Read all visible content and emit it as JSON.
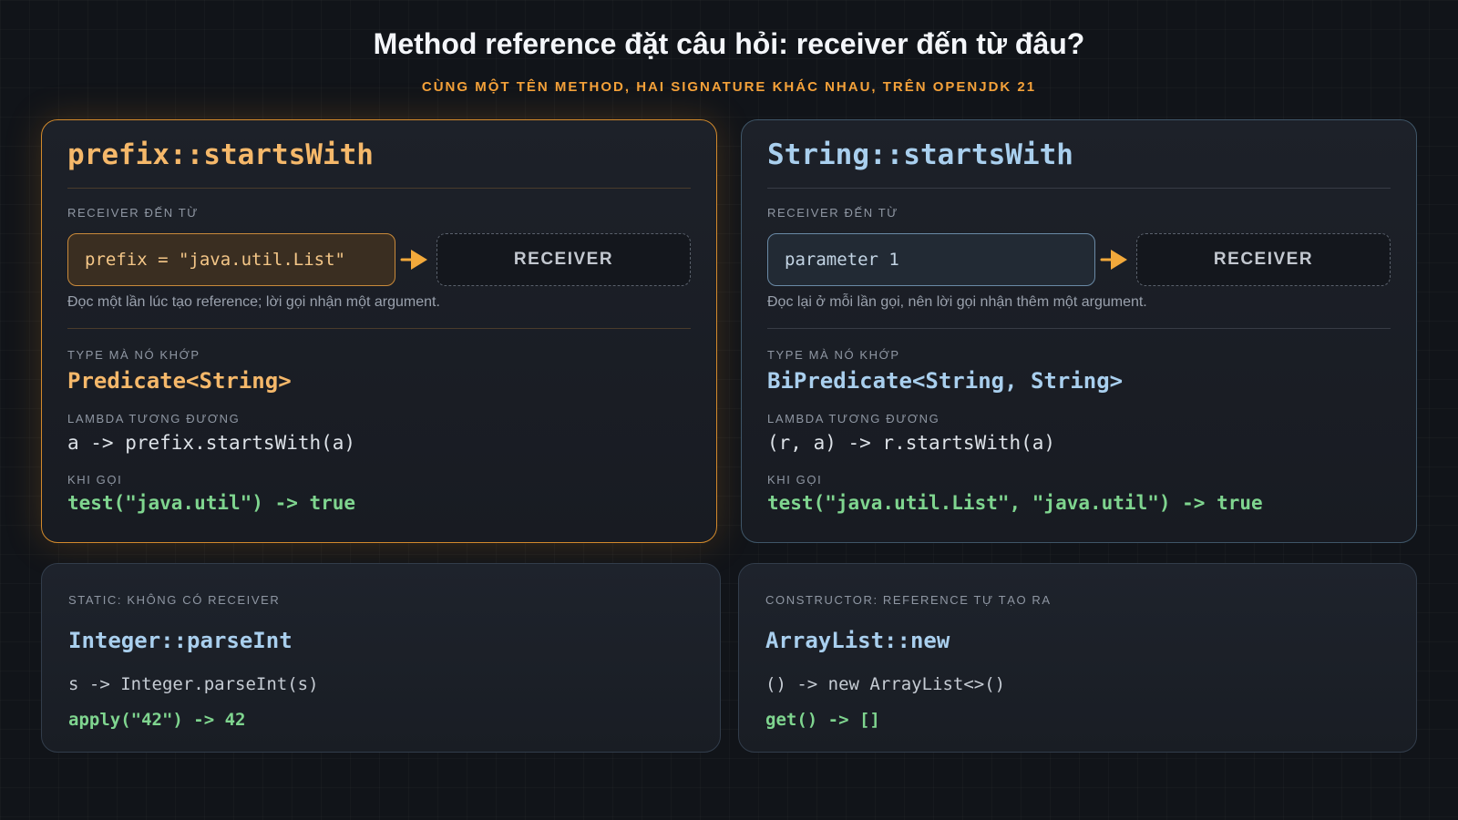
{
  "header": {
    "title": "Method reference đặt câu hỏi: receiver đến từ đâu?",
    "subtitle": "CÙNG MỘT TÊN METHOD, HAI SIGNATURE KHÁC NHAU, TRÊN OPENJDK 21"
  },
  "colors": {
    "accent_orange": "#f5a23a",
    "accent_blue": "#a9cfee",
    "result_green": "#7fd58f",
    "background": "#111419"
  },
  "bound": {
    "name": "prefix::startsWith",
    "receiver_label": "RECEIVER ĐẾN TỪ",
    "source": "prefix = \"java.util.List\"",
    "arrow_icon": "arrow-right-icon",
    "receiver": "RECEIVER",
    "note": "Đọc một lần lúc tạo reference; lời gọi nhận một argument.",
    "type_label": "TYPE MÀ NÓ KHỚP",
    "type": "Predicate<String>",
    "lambda_label": "LAMBDA TƯƠNG ĐƯƠNG",
    "lambda": "a -> prefix.startsWith(a)",
    "call_label": "KHI GỌI",
    "call": "test(\"java.util\") -> true"
  },
  "unbound": {
    "name": "String::startsWith",
    "receiver_label": "RECEIVER ĐẾN TỪ",
    "source": "parameter 1",
    "arrow_icon": "arrow-right-icon",
    "receiver": "RECEIVER",
    "note": "Đọc lại ở mỗi lần gọi, nên lời gọi nhận thêm một argument.",
    "type_label": "TYPE MÀ NÓ KHỚP",
    "type": "BiPredicate<String, String>",
    "lambda_label": "LAMBDA TƯƠNG ĐƯƠNG",
    "lambda": "(r, a) -> r.startsWith(a)",
    "call_label": "KHI GỌI",
    "call": "test(\"java.util.List\", \"java.util\") -> true"
  },
  "static_ref": {
    "label": "STATIC: KHÔNG CÓ RECEIVER",
    "name": "Integer::parseInt",
    "lambda": "s -> Integer.parseInt(s)",
    "call": "apply(\"42\") -> 42"
  },
  "constructor_ref": {
    "label": "CONSTRUCTOR: REFERENCE TỰ TẠO RA",
    "name": "ArrayList::new",
    "lambda": "() -> new ArrayList<>()",
    "call": "get() -> []"
  }
}
